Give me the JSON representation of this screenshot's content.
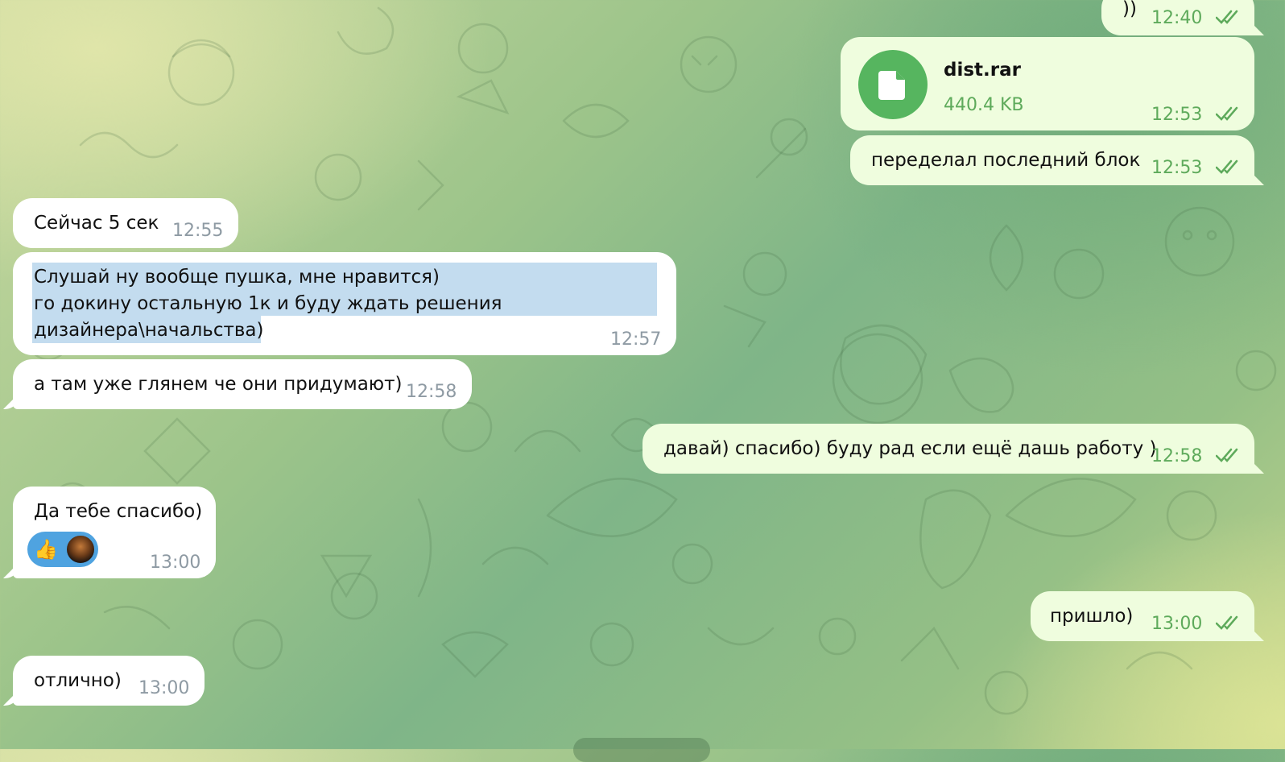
{
  "messages": [
    {
      "id": "m1",
      "side": "out",
      "text": "))",
      "time": "12:40",
      "read": true
    },
    {
      "id": "m2",
      "side": "out",
      "type": "file",
      "file_name": "dist.rar",
      "file_size": "440.4 KB",
      "time": "12:53",
      "read": true
    },
    {
      "id": "m3",
      "side": "out",
      "text": "переделал последний блок",
      "time": "12:53",
      "read": true
    },
    {
      "id": "m4",
      "side": "in",
      "text": "Сейчас 5 сек",
      "time": "12:55"
    },
    {
      "id": "m5",
      "side": "in",
      "lines": [
        "Слушай ну вообще пушка, мне нравится)",
        "го докину остальную 1к и буду ждать решения",
        "дизайнера\\начальства)"
      ],
      "time": "12:57",
      "selected": true
    },
    {
      "id": "m6",
      "side": "in",
      "text": "а там уже глянем че они придумают)",
      "time": "12:58"
    },
    {
      "id": "m7",
      "side": "out",
      "text": "давай) спасибо) буду рад если ещё дашь работу )",
      "time": "12:58",
      "read": true
    },
    {
      "id": "m8",
      "side": "in",
      "text": "Да тебе спасибо)",
      "time": "13:00",
      "reaction": {
        "emoji": "👍",
        "icon": "reactor-avatar"
      }
    },
    {
      "id": "m9",
      "side": "out",
      "text": "пришло)",
      "time": "13:00",
      "read": true
    },
    {
      "id": "m10",
      "side": "in",
      "text": "отлично)",
      "time": "13:00"
    }
  ],
  "colors": {
    "incoming_bubble": "#ffffff",
    "outgoing_bubble": "#effdde",
    "outgoing_time": "#5eaa5b",
    "file_icon": "#56b55f",
    "selection": "#c3dcef",
    "reaction": "#4fa3e0"
  }
}
